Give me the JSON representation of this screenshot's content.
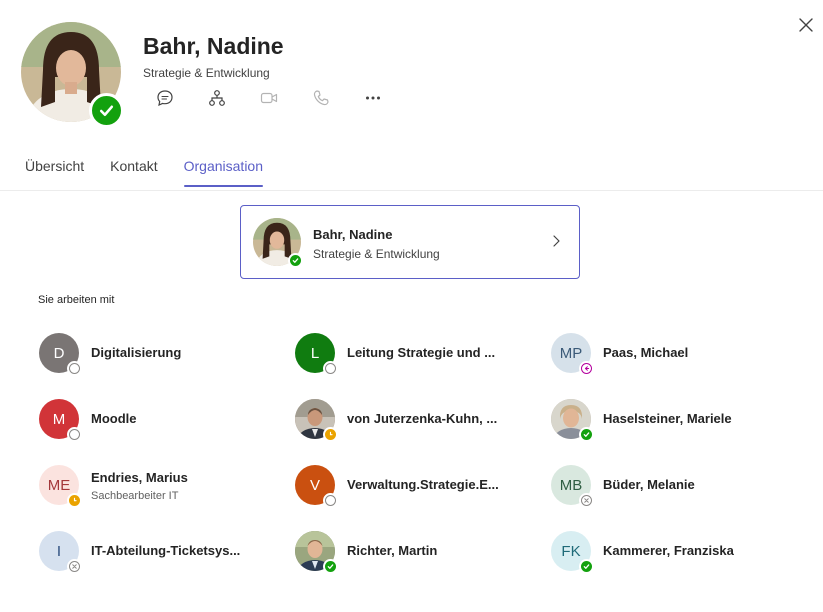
{
  "profile": {
    "name": "Bahr, Nadine",
    "department": "Strategie & Entwicklung",
    "status": "available",
    "status_color": "#13a10e"
  },
  "actions": [
    {
      "name": "chat-icon"
    },
    {
      "name": "org-chart-icon"
    },
    {
      "name": "video-call-icon"
    },
    {
      "name": "audio-call-icon"
    },
    {
      "name": "more-options-icon"
    }
  ],
  "tabs": [
    {
      "label": "Übersicht",
      "active": false
    },
    {
      "label": "Kontakt",
      "active": false
    },
    {
      "label": "Organisation",
      "active": true
    }
  ],
  "accent_color": "#5b5fc7",
  "manager_card": {
    "name": "Bahr, Nadine",
    "department": "Strategie & Entwicklung",
    "status": "available"
  },
  "colleagues_label": "Sie arbeiten mit",
  "colleagues": [
    {
      "initials": "D",
      "name": "Digitalisierung",
      "subtitle": "",
      "avatar_bg": "#7a7574",
      "avatar_fg": "#ffffff",
      "photo": false,
      "status": "offline"
    },
    {
      "initials": "L",
      "name": "Leitung Strategie und ...",
      "subtitle": "",
      "avatar_bg": "#107c10",
      "avatar_fg": "#ffffff",
      "photo": false,
      "status": "offline"
    },
    {
      "initials": "MP",
      "name": "Paas, Michael",
      "subtitle": "",
      "avatar_bg": "#d6e1ea",
      "avatar_fg": "#3b5a78",
      "photo": false,
      "status": "out-of-office"
    },
    {
      "initials": "M",
      "name": "Moodle",
      "subtitle": "",
      "avatar_bg": "#d13438",
      "avatar_fg": "#ffffff",
      "photo": false,
      "status": "offline"
    },
    {
      "initials": "",
      "name": "von Juterzenka-Kuhn, ...",
      "subtitle": "",
      "avatar_bg": "#8a6f5a",
      "avatar_fg": "#ffffff",
      "photo": true,
      "status": "away"
    },
    {
      "initials": "",
      "name": "Haselsteiner, Mariele",
      "subtitle": "",
      "avatar_bg": "#b3a89a",
      "avatar_fg": "#ffffff",
      "photo": true,
      "status": "available"
    },
    {
      "initials": "ME",
      "name": "Endries, Marius",
      "subtitle": "Sachbearbeiter IT",
      "avatar_bg": "#fbe3df",
      "avatar_fg": "#a4373a",
      "photo": false,
      "status": "away"
    },
    {
      "initials": "V",
      "name": "Verwaltung.Strategie.E...",
      "subtitle": "",
      "avatar_bg": "#ca5010",
      "avatar_fg": "#ffffff",
      "photo": false,
      "status": "offline"
    },
    {
      "initials": "MB",
      "name": "Büder, Melanie",
      "subtitle": "",
      "avatar_bg": "#d9e8df",
      "avatar_fg": "#2f5e42",
      "photo": false,
      "status": "unknown"
    },
    {
      "initials": "I",
      "name": "IT-Abteilung-Ticketsys...",
      "subtitle": "",
      "avatar_bg": "#d6e1ef",
      "avatar_fg": "#2b4c7e",
      "photo": false,
      "status": "unknown"
    },
    {
      "initials": "",
      "name": "Richter, Martin",
      "subtitle": "",
      "avatar_bg": "#6f7a5a",
      "avatar_fg": "#ffffff",
      "photo": true,
      "status": "available"
    },
    {
      "initials": "FK",
      "name": "Kammerer, Franziska",
      "subtitle": "",
      "avatar_bg": "#d8eef2",
      "avatar_fg": "#1f6a78",
      "photo": false,
      "status": "available"
    }
  ],
  "status_colors": {
    "available": "#13a10e",
    "away": "#eaa300",
    "offline": "#8a8886",
    "unknown": "#8a8886",
    "out-of-office": "#b4009e"
  }
}
